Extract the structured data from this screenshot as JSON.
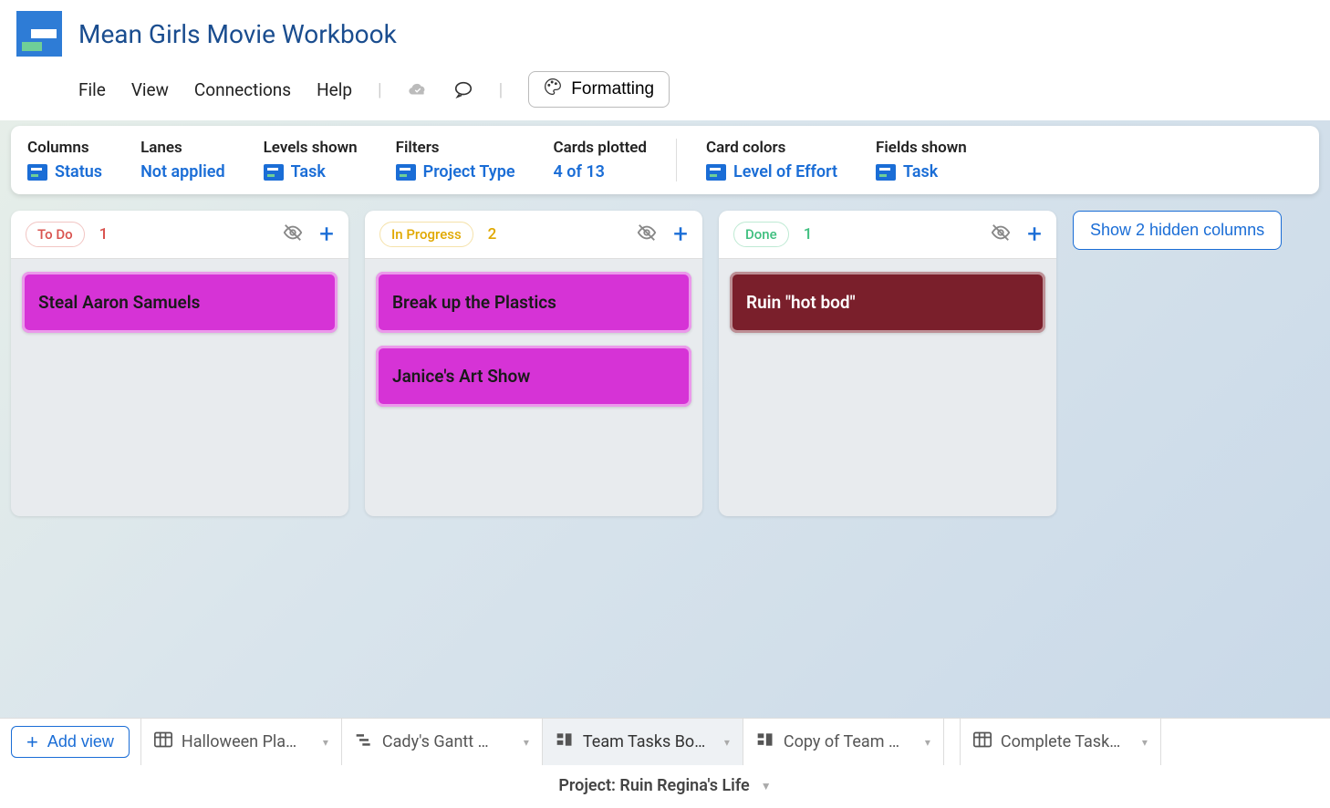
{
  "header": {
    "title": "Mean Girls Movie Workbook",
    "menu": [
      "File",
      "View",
      "Connections",
      "Help"
    ],
    "formatting_label": "Formatting"
  },
  "config": {
    "columns": {
      "label": "Columns",
      "value": "Status"
    },
    "lanes": {
      "label": "Lanes",
      "value": "Not applied"
    },
    "levels": {
      "label": "Levels shown",
      "value": "Task"
    },
    "filters": {
      "label": "Filters",
      "value": "Project Type"
    },
    "cards_plotted": {
      "label": "Cards plotted",
      "value": "4 of 13"
    },
    "card_colors": {
      "label": "Card colors",
      "value": "Level of Effort"
    },
    "fields_shown": {
      "label": "Fields shown",
      "value": "Task"
    }
  },
  "columns": [
    {
      "title": "To Do",
      "count": "1",
      "color": "#d9534f",
      "cards": [
        {
          "title": "Steal Aaron Samuels",
          "color": "magenta"
        }
      ]
    },
    {
      "title": "In Progress",
      "count": "2",
      "color": "#e0a800",
      "cards": [
        {
          "title": "Break up the Plastics",
          "color": "magenta"
        },
        {
          "title": "Janice's Art Show",
          "color": "magenta"
        }
      ]
    },
    {
      "title": "Done",
      "count": "1",
      "color": "#3fbf7f",
      "cards": [
        {
          "title": "Ruin \"hot bod\"",
          "color": "maroon"
        }
      ]
    }
  ],
  "show_hidden_label": "Show 2 hidden columns",
  "tabs": {
    "add_view_label": "Add view",
    "items": [
      {
        "label": "Halloween Pla…",
        "icon": "table",
        "active": false
      },
      {
        "label": "Cady's Gantt …",
        "icon": "gantt",
        "active": false
      },
      {
        "label": "Team Tasks Bo…",
        "icon": "board",
        "active": true
      },
      {
        "label": "Copy of Team …",
        "icon": "board",
        "active": false
      },
      {
        "label": "Complete Task…",
        "icon": "table",
        "active": false
      }
    ]
  },
  "footer": {
    "project_label": "Project: Ruin Regina's Life"
  }
}
